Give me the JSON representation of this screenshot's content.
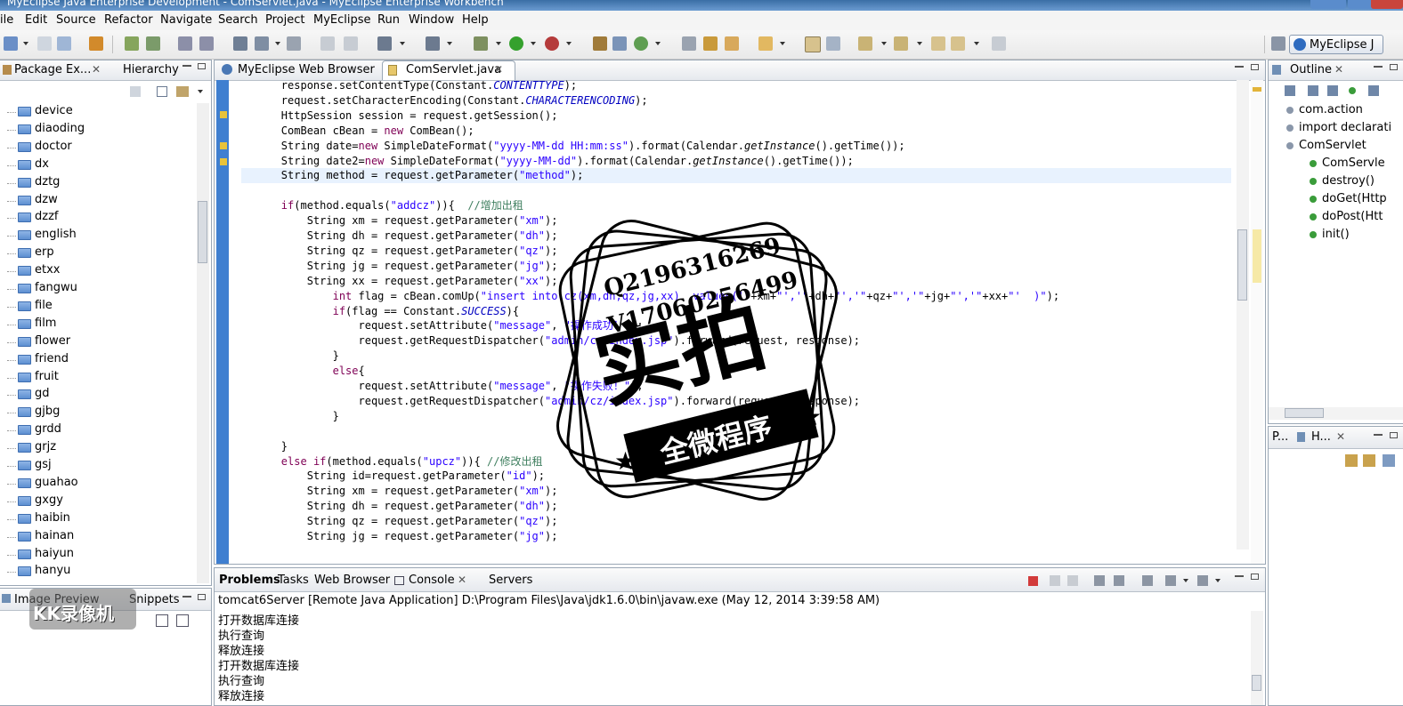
{
  "window": {
    "title": "MyEclipse Java Enterprise Development - ComServlet.java - MyEclipse Enterprise Workbench"
  },
  "menu": [
    "ile",
    "Edit",
    "Source",
    "Refactor",
    "Navigate",
    "Search",
    "Project",
    "MyEclipse",
    "Run",
    "Window",
    "Help"
  ],
  "perspective": {
    "label": "MyEclipse J"
  },
  "package_explorer": {
    "tab_label": "Package Ex...",
    "hierarchy_label": "Hierarchy",
    "items": [
      "device",
      "diaoding",
      "doctor",
      "dx",
      "dztg",
      "dzw",
      "dzzf",
      "english",
      "erp",
      "etxx",
      "fangwu",
      "file",
      "film",
      "flower",
      "friend",
      "fruit",
      "gd",
      "gjbg",
      "grdd",
      "grjz",
      "gsj",
      "guahao",
      "gxgy",
      "haibin",
      "hainan",
      "haiyun",
      "hanyu"
    ]
  },
  "image_preview": {
    "tab_label": "Image Preview",
    "snippets_label": "Snippets",
    "watermark": "KK录像机"
  },
  "editor": {
    "tabs": [
      {
        "label": "MyEclipse Web Browser",
        "active": false
      },
      {
        "label": "ComServlet.java",
        "active": true
      }
    ],
    "lines": [
      "        response.setContentType(Constant.CONTENTTYPE);",
      "        request.setCharacterEncoding(Constant.CHARACTERENCODING);",
      "        HttpSession session = request.getSession();",
      "        ComBean cBean = new ComBean();",
      "        String date=new SimpleDateFormat(\"yyyy-MM-dd HH:mm:ss\").format(Calendar.getInstance().getTime());",
      "        String date2=new SimpleDateFormat(\"yyyy-MM-dd\").format(Calendar.getInstance().getTime());",
      "        String method = request.getParameter(\"method\");",
      "",
      "        if(method.equals(\"addcz\")){  //增加出租",
      "            String xm = request.getParameter(\"xm\");",
      "            String dh = request.getParameter(\"dh\");",
      "            String qz = request.getParameter(\"qz\");",
      "            String jg = request.getParameter(\"jg\");",
      "            String xx = request.getParameter(\"xx\");",
      "                int flag = cBean.comUp(\"insert into cz(xm,dh,qz,jg,xx)  values('\"+xm+\"','\"+dh+\"','\"+qz+\"','\"+jg+\"','\"+xx+\"'  )\");",
      "                if(flag == Constant.SUCCESS){",
      "                    request.setAttribute(\"message\", \"操作成功！\");",
      "                    request.getRequestDispatcher(\"admin/cz/index.jsp\").forward(request, response);",
      "                }",
      "                else{",
      "                    request.setAttribute(\"message\", \"操作失败！\");",
      "                    request.getRequestDispatcher(\"admin/cz/index.jsp\").forward(request, response);",
      "                }",
      "",
      "        }",
      "        else if(method.equals(\"upcz\")){ //修改出租",
      "            String id=request.getParameter(\"id\");",
      "            String xm = request.getParameter(\"xm\");",
      "            String dh = request.getParameter(\"dh\");",
      "            String qz = request.getParameter(\"qz\");",
      "            String jg = request.getParameter(\"jg\");"
    ]
  },
  "outline": {
    "tab_label": "Outline",
    "items": [
      {
        "label": "com.action",
        "indent": 0
      },
      {
        "label": "import declarati",
        "indent": 0
      },
      {
        "label": "ComServlet",
        "indent": 0
      },
      {
        "label": "ComServle",
        "indent": 1
      },
      {
        "label": "destroy()",
        "indent": 1
      },
      {
        "label": "doGet(Http",
        "indent": 1
      },
      {
        "label": "doPost(Htt",
        "indent": 1
      },
      {
        "label": "init()",
        "indent": 1
      }
    ]
  },
  "side_mini": {
    "tab1": "P...",
    "tab2": "H..."
  },
  "bottom": {
    "tabs": [
      "Problems",
      "Tasks",
      "Web Browser",
      "Console",
      "Servers"
    ],
    "console_header": "tomcat6Server [Remote Java Application] D:\\Program Files\\Java\\jdk1.6.0\\bin\\javaw.exe (May 12, 2014 3:39:58 AM)",
    "console_lines": [
      "打开数据库连接",
      "执行查询",
      "释放连接",
      "打开数据库连接",
      "执行查询",
      "释放连接"
    ]
  },
  "stamp": {
    "line1": "Q2196316269",
    "line2": "V17060256499",
    "big": "实拍",
    "band": "全微程序"
  },
  "colors": {
    "accent": "#3a6ea5",
    "keyword": "#7f0055",
    "string": "#2a00ff",
    "comment": "#3f7f5f",
    "constant": "#0000c0"
  }
}
